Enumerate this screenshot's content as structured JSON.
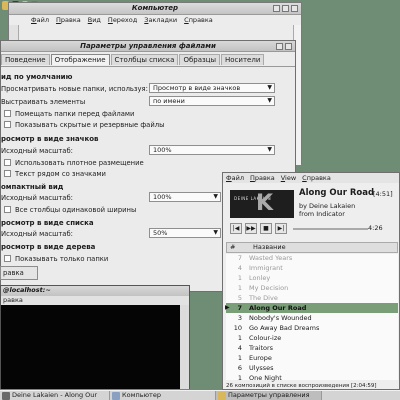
{
  "panel": {
    "icons": [
      "folder-icon",
      "terminal-icon",
      "star-icon",
      "red-app-icon"
    ]
  },
  "file_manager": {
    "title": "Компьютер",
    "menu": [
      "Файл",
      "Правка",
      "Вид",
      "Переход",
      "Закладки",
      "Справка"
    ]
  },
  "dialog": {
    "title": "Параметры управления файлами",
    "tabs": [
      "Поведение",
      "Отображение",
      "Столбцы списка",
      "Образцы",
      "Носители"
    ],
    "sec_default": "ид по умолчанию",
    "view_new_label": "Просматривать новые папки, используя:",
    "view_new_value": "Просмотр в виде значков",
    "arrange_label": "Выстраивать элементы",
    "arrange_value": "по имени",
    "folders_first": "Помещать папки перед файлами",
    "show_hidden": "Показывать скрытые и резервные файлы",
    "sec_icons": "росмотр в виде значков",
    "icons_zoom_label": "Исходный масштаб:",
    "icons_zoom_value": "100%",
    "compact_layout": "Использовать плотное размещение",
    "text_beside": "Текст рядом со значками",
    "sec_compact": "омпактный вид",
    "compact_zoom_label": "Исходный масштаб:",
    "compact_zoom_value": "100%",
    "same_width": "Все столбцы одинаковой ширины",
    "sec_list": "росмотр в виде списка",
    "list_zoom_label": "Исходный масштаб:",
    "list_zoom_value": "50%",
    "sec_tree": "росмотр в виде дерева",
    "folders_only": "Показывать только папки",
    "ref_button": "равка"
  },
  "terminal": {
    "title": "@localhost:~",
    "menu": "равка"
  },
  "player": {
    "menu": [
      "Файл",
      "Правка",
      "View",
      "Справка"
    ],
    "cover_band": "DEINE LAKAIEN",
    "cover_letter": "K",
    "title": "Along Our Road",
    "duration": "[4:51]",
    "by": "by Deine Lakaien",
    "from": "from Indicator",
    "controls": [
      "|◀",
      "▶▶",
      "■",
      "▶|"
    ],
    "position": "4:26",
    "col_num": "#",
    "col_name": "Название",
    "tracks": [
      {
        "n": "7",
        "t": "Wasted Years",
        "state": "played"
      },
      {
        "n": "4",
        "t": "Immigrant",
        "state": "played"
      },
      {
        "n": "1",
        "t": "Lonley",
        "state": "played"
      },
      {
        "n": "1",
        "t": "My Decision",
        "state": "played"
      },
      {
        "n": "5",
        "t": "The Dive",
        "state": "played"
      },
      {
        "n": "7",
        "t": "Along Our Road",
        "state": "current"
      },
      {
        "n": "3",
        "t": "Nobody's Wounded",
        "state": ""
      },
      {
        "n": "10",
        "t": "Go Away Bad Dreams",
        "state": ""
      },
      {
        "n": "1",
        "t": "Colour-ize",
        "state": ""
      },
      {
        "n": "4",
        "t": "Traitors",
        "state": ""
      },
      {
        "n": "1",
        "t": "Europe",
        "state": ""
      },
      {
        "n": "6",
        "t": "Ulysses",
        "state": ""
      },
      {
        "n": "1",
        "t": "One Night",
        "state": ""
      }
    ],
    "status": "26 композиций в списке воспроизведения [2:04:59]"
  },
  "taskbar": {
    "items": [
      "Deine Lakaien - Along Our",
      "Компьютер",
      "Параметры управления"
    ]
  },
  "colors": {
    "desktop": "#6f8c74",
    "current_track": "#7a9e78"
  }
}
